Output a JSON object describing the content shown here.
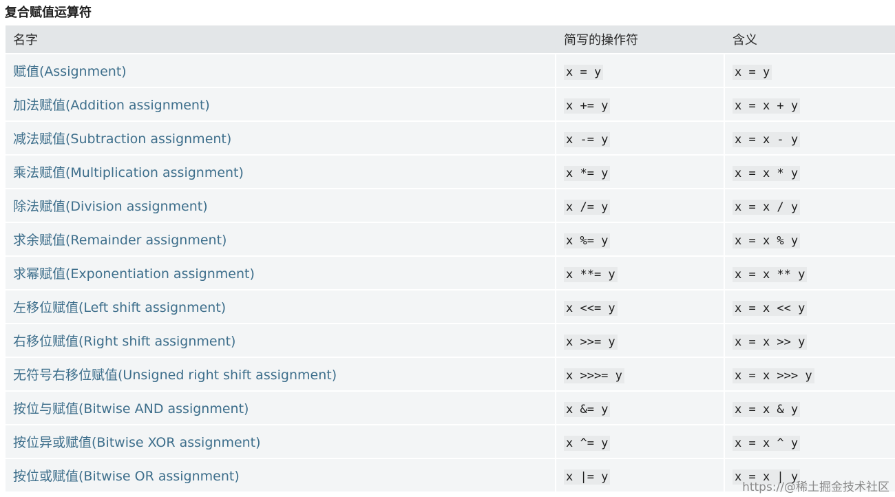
{
  "title": "复合赋值运算符",
  "table": {
    "headers": [
      "名字",
      "简写的操作符",
      "含义"
    ],
    "rows": [
      {
        "name": "赋值(Assignment)",
        "op": "x = y",
        "meaning": "x = y"
      },
      {
        "name": "加法赋值(Addition assignment)",
        "op": "x += y",
        "meaning": "x = x + y"
      },
      {
        "name": "减法赋值(Subtraction assignment)",
        "op": "x -= y",
        "meaning": "x = x - y"
      },
      {
        "name": "乘法赋值(Multiplication assignment)",
        "op": "x *= y",
        "meaning": "x = x * y"
      },
      {
        "name": "除法赋值(Division assignment)",
        "op": "x /= y",
        "meaning": "x = x / y"
      },
      {
        "name": "求余赋值(Remainder assignment)",
        "op": "x %= y",
        "meaning": "x = x % y"
      },
      {
        "name": "求幂赋值(Exponentiation assignment)",
        "op": "x **= y",
        "meaning": "x = x ** y"
      },
      {
        "name": "左移位赋值(Left shift assignment)",
        "op": "x <<= y",
        "meaning": "x = x << y"
      },
      {
        "name": "右移位赋值(Right shift assignment)",
        "op": "x >>= y",
        "meaning": "x = x >> y"
      },
      {
        "name": "无符号右移位赋值(Unsigned right shift assignment)",
        "op": "x >>>= y",
        "meaning": "x = x >>> y"
      },
      {
        "name": "按位与赋值(Bitwise AND assignment)",
        "op": "x &= y",
        "meaning": "x = x & y"
      },
      {
        "name": "按位异或赋值(Bitwise XOR assignment)",
        "op": "x ^= y",
        "meaning": "x = x ^ y"
      },
      {
        "name": "按位或赋值(Bitwise OR assignment)",
        "op": "x |= y",
        "meaning": "x = x | y"
      }
    ]
  },
  "watermark": "https://@稀土掘金技术社区"
}
